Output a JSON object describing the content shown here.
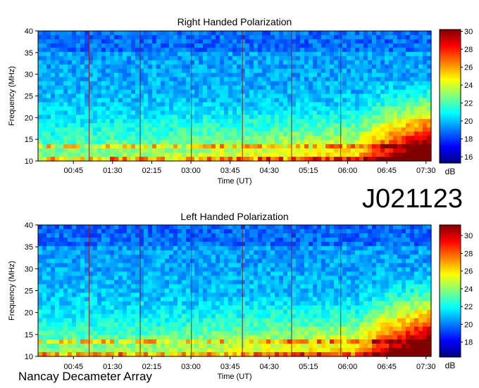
{
  "observation_id": "J021123",
  "credit": "Nancay Decameter Array",
  "chart_data": [
    {
      "type": "heatmap",
      "title": "Right Handed Polarization",
      "xlabel": "Time (UT)",
      "ylabel": "Frequency (MHz)",
      "x_ticks": [
        "00:45",
        "01:30",
        "02:15",
        "03:00",
        "03:45",
        "04:30",
        "05:15",
        "06:00",
        "06:45",
        "07:30"
      ],
      "y_ticks": [
        10,
        15,
        20,
        25,
        30,
        35,
        40
      ],
      "ylim": [
        10,
        40
      ],
      "colorbar": {
        "label": "dB",
        "ticks": [
          16,
          18,
          20,
          22,
          24,
          26,
          28,
          30
        ],
        "range": [
          15.3,
          30.2
        ]
      },
      "colormap": [
        "#00007f",
        "#0000ff",
        "#007fff",
        "#00ffff",
        "#7fff7f",
        "#ffff00",
        "#ff7f00",
        "#ff0000",
        "#7f0000"
      ],
      "grid": false
    },
    {
      "type": "heatmap",
      "title": "Left Handed Polarization",
      "xlabel": "Time (UT)",
      "ylabel": "Frequency (MHz)",
      "x_ticks": [
        "00:45",
        "01:30",
        "02:15",
        "03:00",
        "03:45",
        "04:30",
        "05:15",
        "06:00",
        "06:45",
        "07:30"
      ],
      "y_ticks": [
        10,
        15,
        20,
        25,
        30,
        35,
        40
      ],
      "ylim": [
        10,
        40
      ],
      "colorbar": {
        "label": "dB",
        "ticks": [
          18,
          20,
          22,
          24,
          26,
          28,
          30
        ],
        "range": [
          16.3,
          31.2
        ]
      },
      "colormap": [
        "#00007f",
        "#0000ff",
        "#007fff",
        "#00ffff",
        "#7fff7f",
        "#ffff00",
        "#ff7f00",
        "#ff0000",
        "#7f0000"
      ],
      "grid": false
    }
  ]
}
